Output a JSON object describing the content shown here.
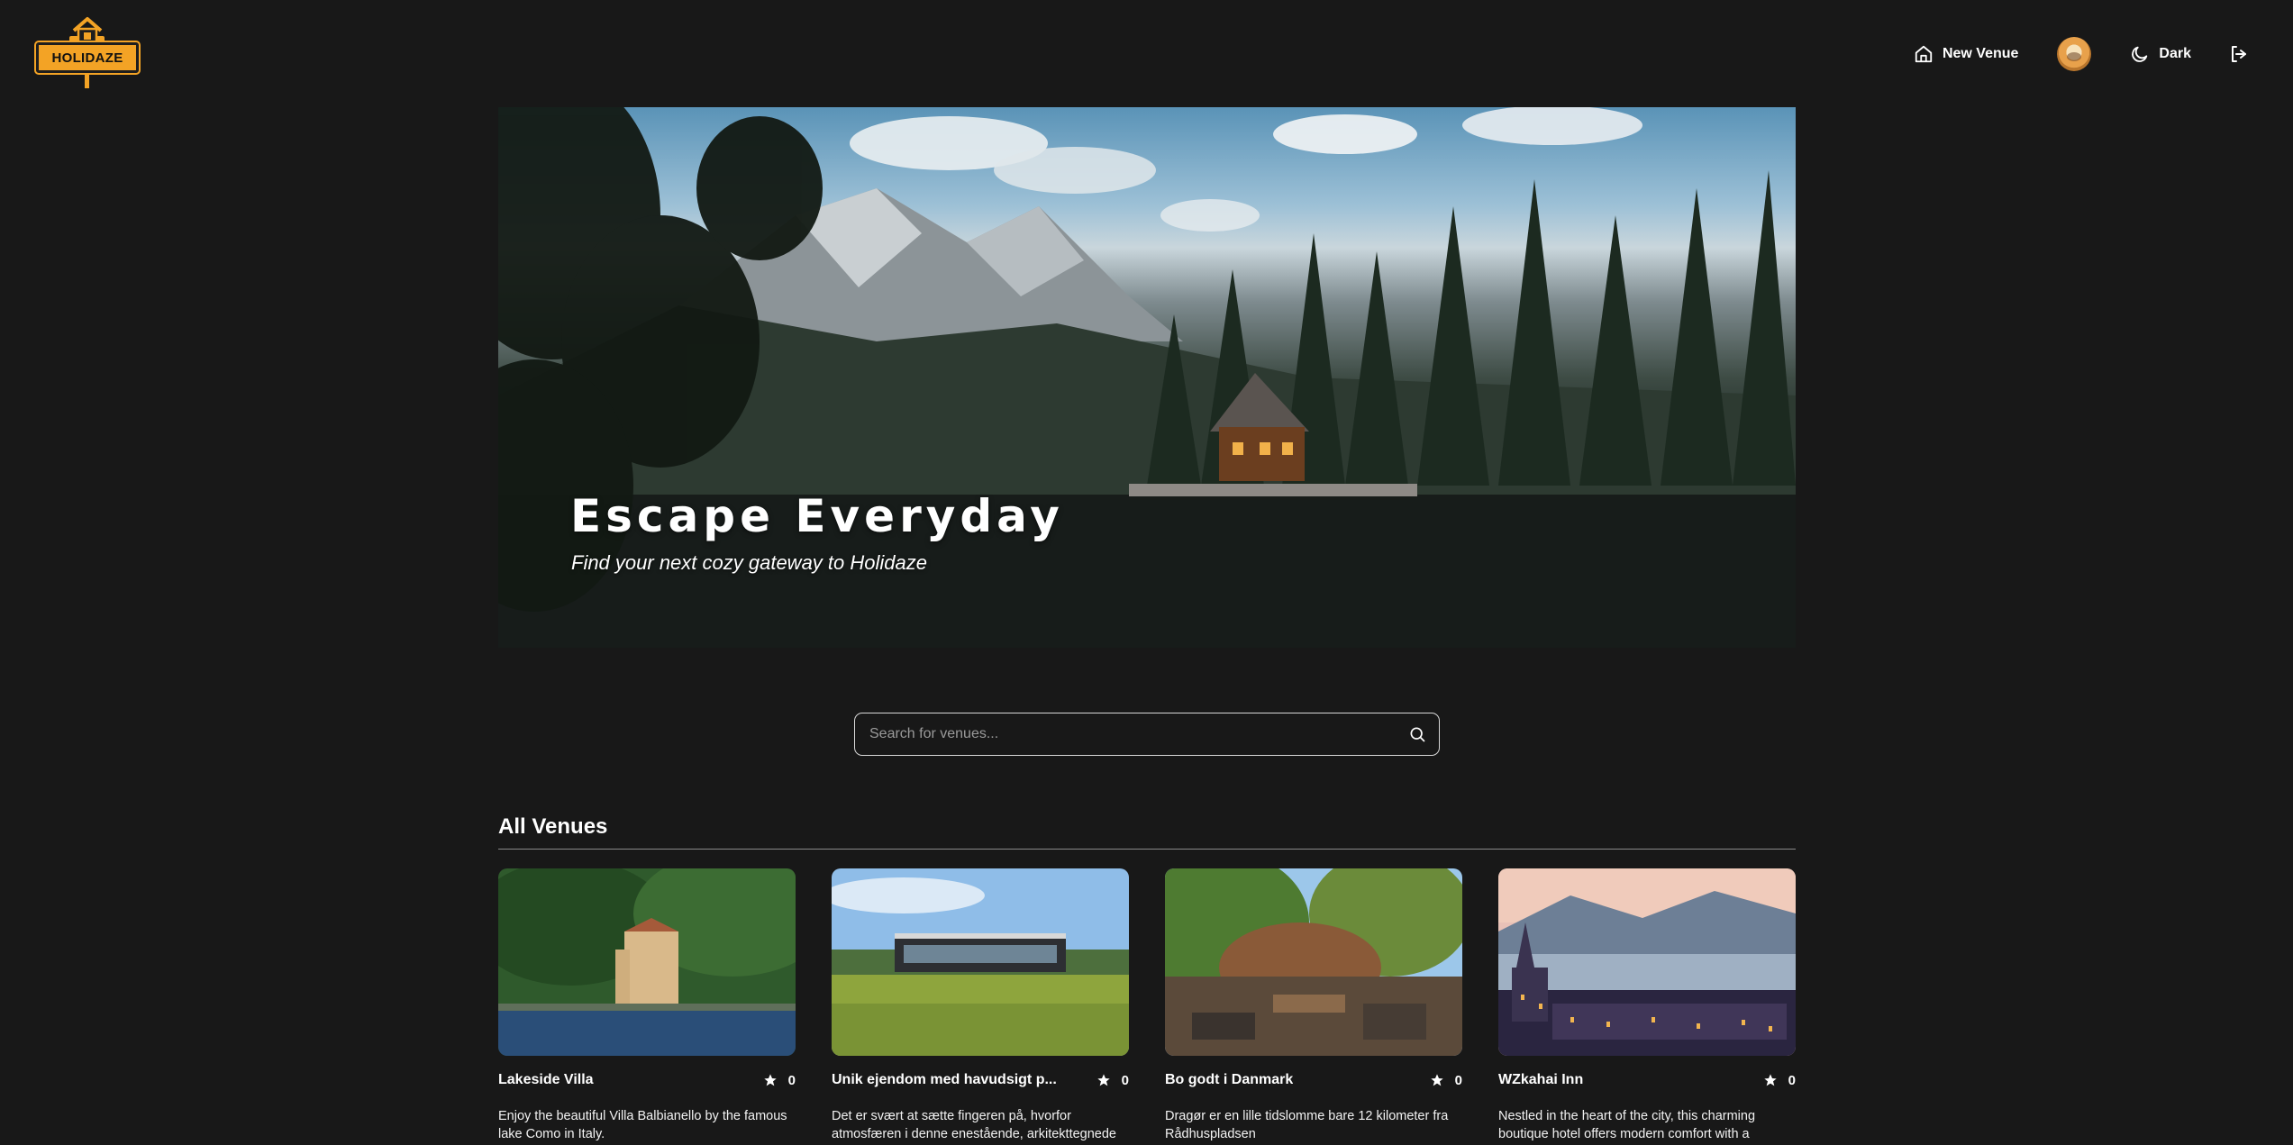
{
  "header": {
    "logo_text": "HOLIDAZE",
    "nav": {
      "new_venue_label": "New Venue",
      "theme_label": "Dark"
    }
  },
  "hero": {
    "title": "Escape Everyday",
    "subtitle": "Find your next cozy gateway to Holidaze"
  },
  "search": {
    "placeholder": "Search for venues...",
    "value": ""
  },
  "venues_section": {
    "title": "All Venues",
    "cards": [
      {
        "title": "Lakeside Villa",
        "rating": "0",
        "description": "Enjoy the beautiful Villa Balbianello by the famous lake Como in Italy."
      },
      {
        "title": "Unik ejendom med havudsigt p...",
        "rating": "0",
        "description": "Det er svært at sætte fingeren på, hvorfor atmosfæren i denne enestående, arkitekttegnede"
      },
      {
        "title": "Bo godt i Danmark",
        "rating": "0",
        "description": "Dragør er en lille tidslomme bare 12 kilometer fra Rådhuspladsen"
      },
      {
        "title": "WZkahai Inn",
        "rating": "0",
        "description": "Nestled in the heart of the city, this charming boutique hotel offers modern comfort with a"
      }
    ]
  },
  "colors": {
    "background": "#181818",
    "brand_yellow": "#f3a325",
    "text": "#ffffff"
  }
}
